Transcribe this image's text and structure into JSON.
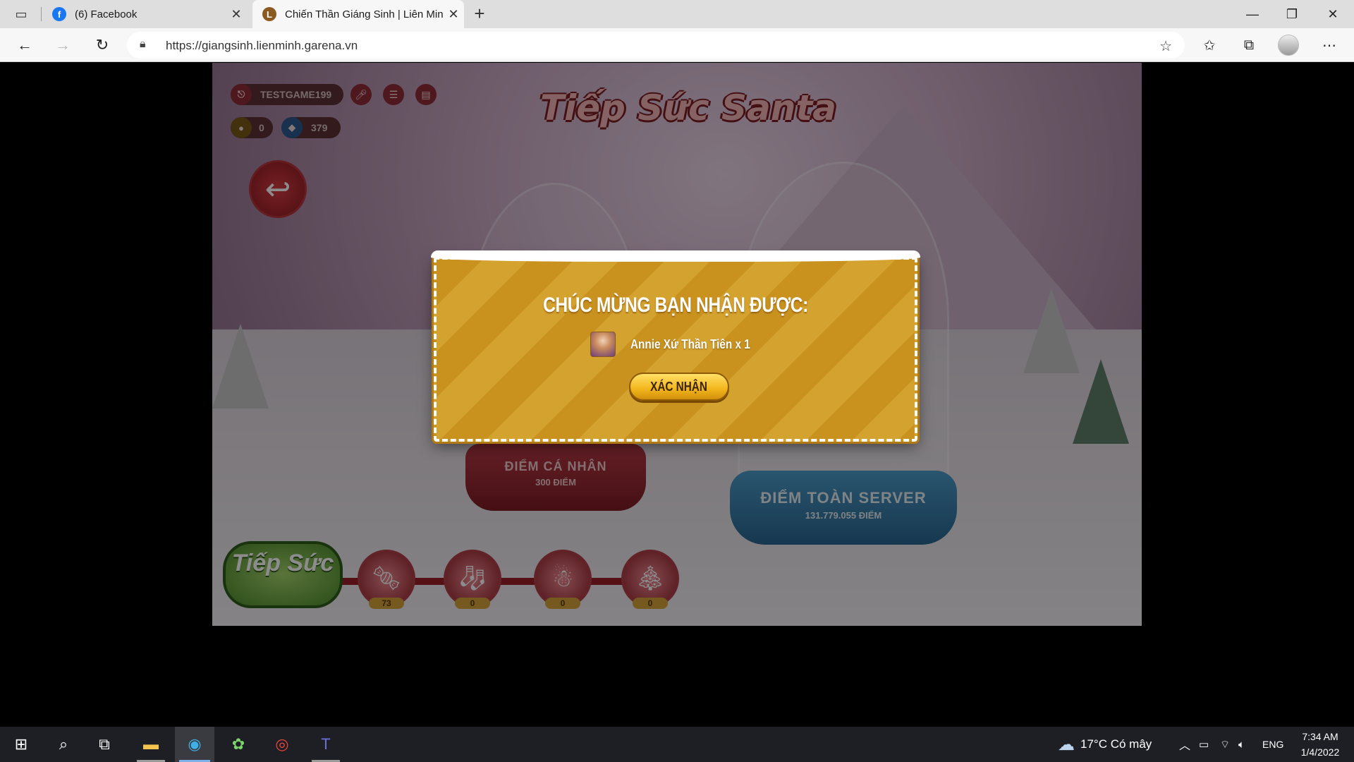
{
  "browser": {
    "tabs": [
      {
        "title": "(6) Facebook",
        "icon": "facebook-icon",
        "color": "#1877f2"
      },
      {
        "title": "Chiến Thần Giáng Sinh | Liên Min",
        "icon": "lienminh-icon",
        "color": "#8a5a20"
      }
    ],
    "url": "https://giangsinh.lienminh.garena.vn"
  },
  "game": {
    "username": "TESTGAME199",
    "coins": "0",
    "gems": "379",
    "event_title": "Tiếp Sức Santa",
    "personal_label": "ĐIỂM CÁ NHÂN",
    "personal_points": "300 ĐIỂM",
    "server_label": "ĐIỂM TOÀN SERVER",
    "server_points": "131.779.055 ĐIỂM",
    "tiep_suc_label": "Tiếp Sức",
    "items": [
      {
        "icon": "candy-cane-icon",
        "count": "73"
      },
      {
        "icon": "stocking-icon",
        "count": "0"
      },
      {
        "icon": "snowman-icon",
        "count": "0"
      },
      {
        "icon": "christmas-tree-icon",
        "count": "0"
      }
    ]
  },
  "modal": {
    "title": "CHÚC MỪNG BẠN NHẬN ĐƯỢC:",
    "reward": "Annie Xứ Thần Tiên x 1",
    "confirm": "XÁC NHẬN"
  },
  "taskbar": {
    "weather": "17°C  Có mây",
    "lang": "ENG",
    "time": "7:34 AM",
    "date": "1/4/2022"
  }
}
